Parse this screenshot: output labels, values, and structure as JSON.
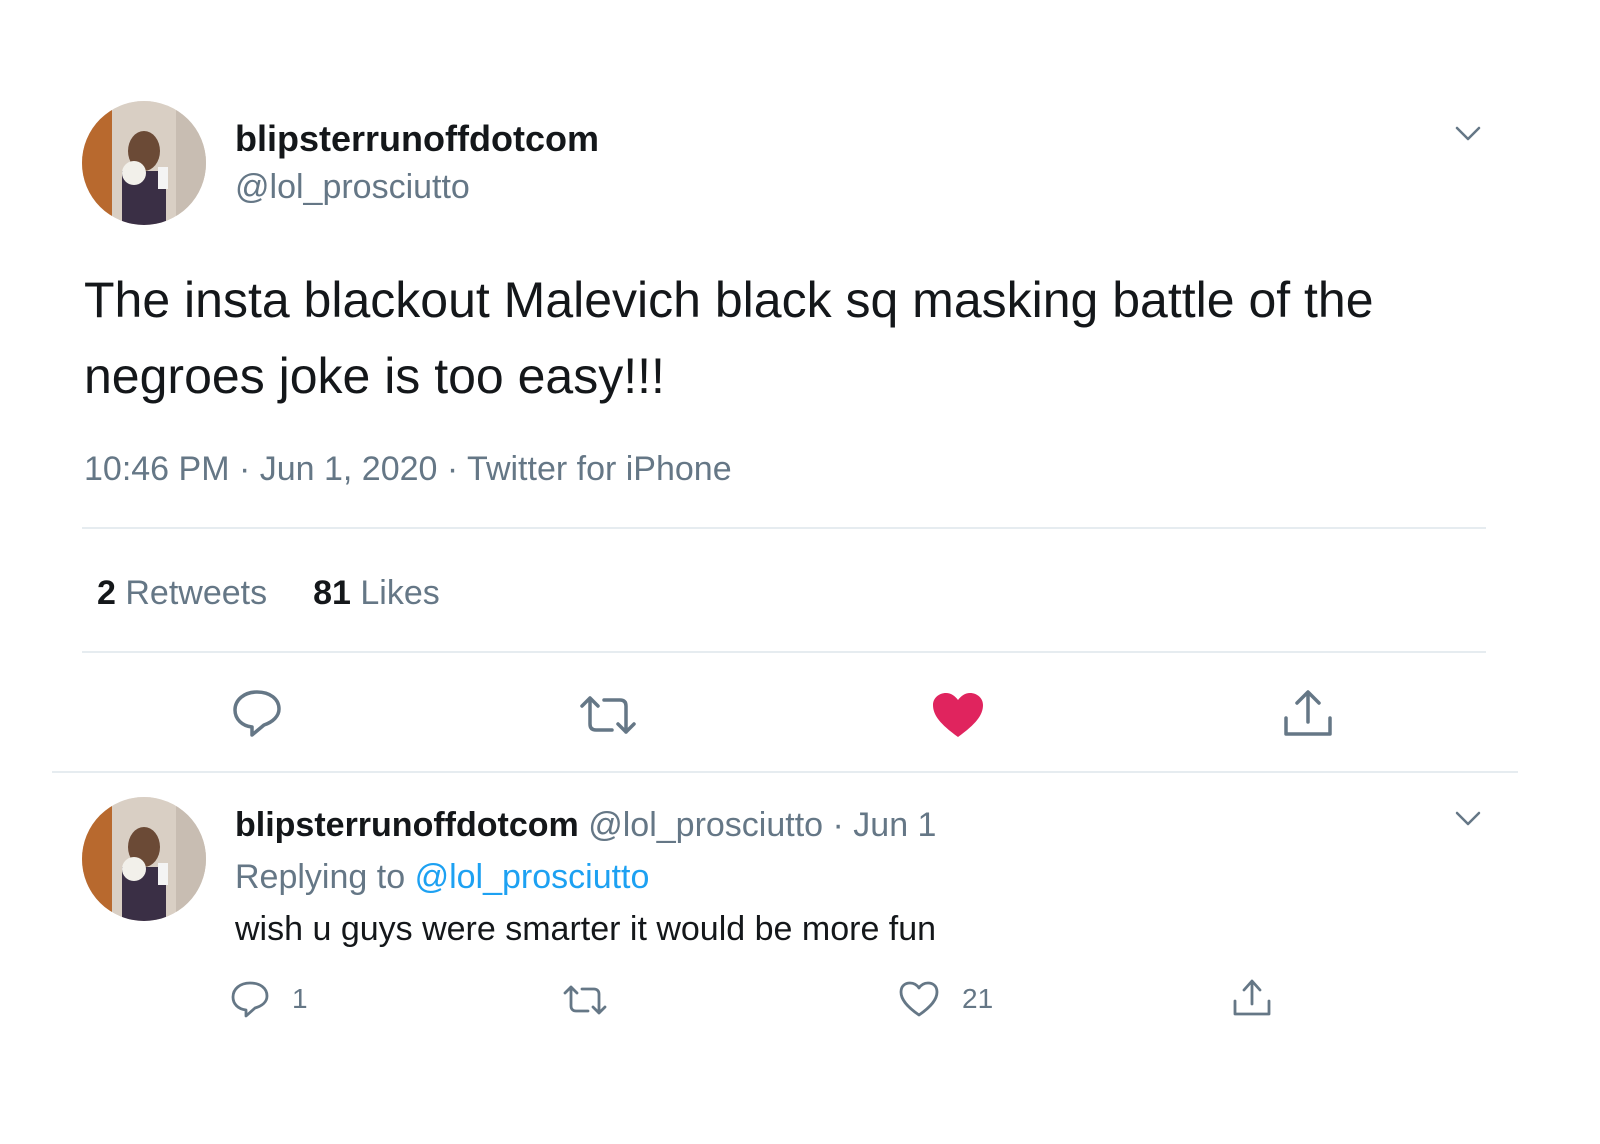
{
  "main_tweet": {
    "display_name": "blipsterrunoffdotcom",
    "handle": "@lol_prosciutto",
    "text": "The insta blackout Malevich black sq masking battle of the negroes joke is too easy!!!",
    "meta": "10:46 PM · Jun 1, 2020 · Twitter for iPhone",
    "retweets_count": "2",
    "retweets_label": "Retweets",
    "likes_count": "81",
    "likes_label": "Likes",
    "liked": true,
    "like_color": "#e0245e"
  },
  "reply_tweet": {
    "display_name": "blipsterrunoffdotcom",
    "handle_date": "@lol_prosciutto · Jun 1",
    "replying_prefix": "Replying to",
    "replying_to": "@lol_prosciutto",
    "text": "wish u guys were smarter it would be more fun",
    "reply_count": "1",
    "like_count": "21"
  },
  "colors": {
    "text": "#14171a",
    "secondary": "#657786",
    "link": "#1da1f2",
    "divider": "#e6ecf0"
  },
  "icons": [
    "chevron-down-icon",
    "reply-icon",
    "retweet-icon",
    "heart-icon",
    "share-icon"
  ]
}
